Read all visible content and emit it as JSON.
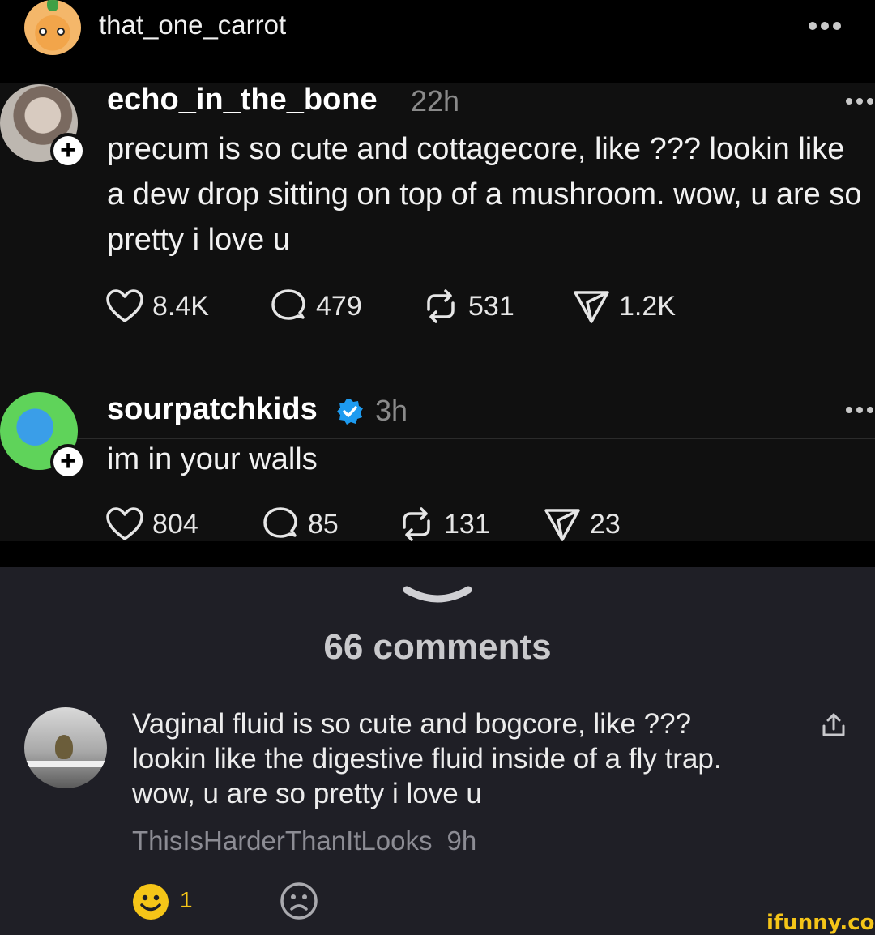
{
  "header": {
    "username": "that_one_carrot",
    "more_icon": "more-dots-icon"
  },
  "posts": [
    {
      "username": "echo_in_the_bone",
      "time": "22h",
      "text": "precum is so cute and cottagecore, like ??? lookin like a dew drop sitting on top of a mushroom. wow, u are so pretty i love u",
      "likes": "8.4K",
      "replies": "479",
      "reposts": "531",
      "shares": "1.2K"
    },
    {
      "username": "sourpatchkids",
      "time": "3h",
      "verified": true,
      "text": "im in your walls",
      "likes": "804",
      "replies": "85",
      "reposts": "131",
      "shares": "23"
    }
  ],
  "comments_section": {
    "title": "66 comments",
    "comment": {
      "text": "Vaginal fluid is so cute and bogcore, like ??? lookin like the digestive fluid inside of a fly trap. wow, u are so pretty i love u",
      "author": "ThisIsHarderThanItLooks",
      "time": "9h",
      "smile_count": "1"
    }
  },
  "watermark": "ifunny.co",
  "colors": {
    "accent_yellow": "#f5c518",
    "verified_blue": "#1d9bf0",
    "background": "#1f1f26",
    "thread_bg": "#101010"
  }
}
